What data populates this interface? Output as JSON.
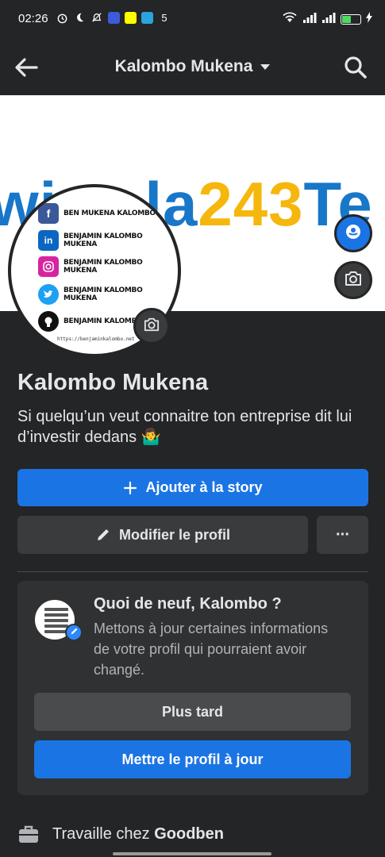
{
  "status_bar": {
    "time": "02:26",
    "network_label": "5"
  },
  "app_bar": {
    "title": "Kalombo Mukena",
    "back_icon": "back-arrow-icon",
    "search_icon": "search-icon"
  },
  "cover": {
    "text_blue_1": "wi",
    "text_blue_2": "la",
    "text_yellow": "243",
    "text_blue_3": "Te"
  },
  "avatar_card": {
    "rows": [
      {
        "network": "facebook",
        "label": "BEN MUKENA KALOMBO",
        "color": "#3b5998"
      },
      {
        "network": "linkedin",
        "label": "BENJAMIN KALOMBO MUKENA",
        "color": "#0a66c2"
      },
      {
        "network": "instagram",
        "label": "BENJAMIN KALOMBO MUKENA",
        "color": "#d6249f"
      },
      {
        "network": "twitter",
        "label": "BENJAMIN KALOMBO MUKENA",
        "color": "#1da1f2"
      },
      {
        "network": "github",
        "label": "BENJAMIN KALOMBO MU",
        "color": "#111111"
      }
    ],
    "url": "https://benjaminkalombo.net"
  },
  "profile": {
    "name": "Kalombo Mukena",
    "bio": "Si quelqu’un veut connaitre ton entreprise dit lui d’investir dedans 🤷‍♂️"
  },
  "actions": {
    "add_story": "Ajouter à la story",
    "edit_profile": "Modifier le profil",
    "more": "···"
  },
  "prompt_card": {
    "title": "Quoi de neuf, Kalombo ?",
    "text": "Mettons à jour certaines informations de votre profil qui pourraient avoir changé.",
    "later": "Plus tard",
    "update": "Mettre le profil à jour"
  },
  "work": {
    "prefix": "Travaille chez ",
    "company": "Goodben"
  },
  "colors": {
    "background": "#242526",
    "primary": "#1b74e4",
    "secondary_button": "#3a3b3c",
    "cover_blue": "#1877c9",
    "cover_yellow": "#f5b70c"
  }
}
